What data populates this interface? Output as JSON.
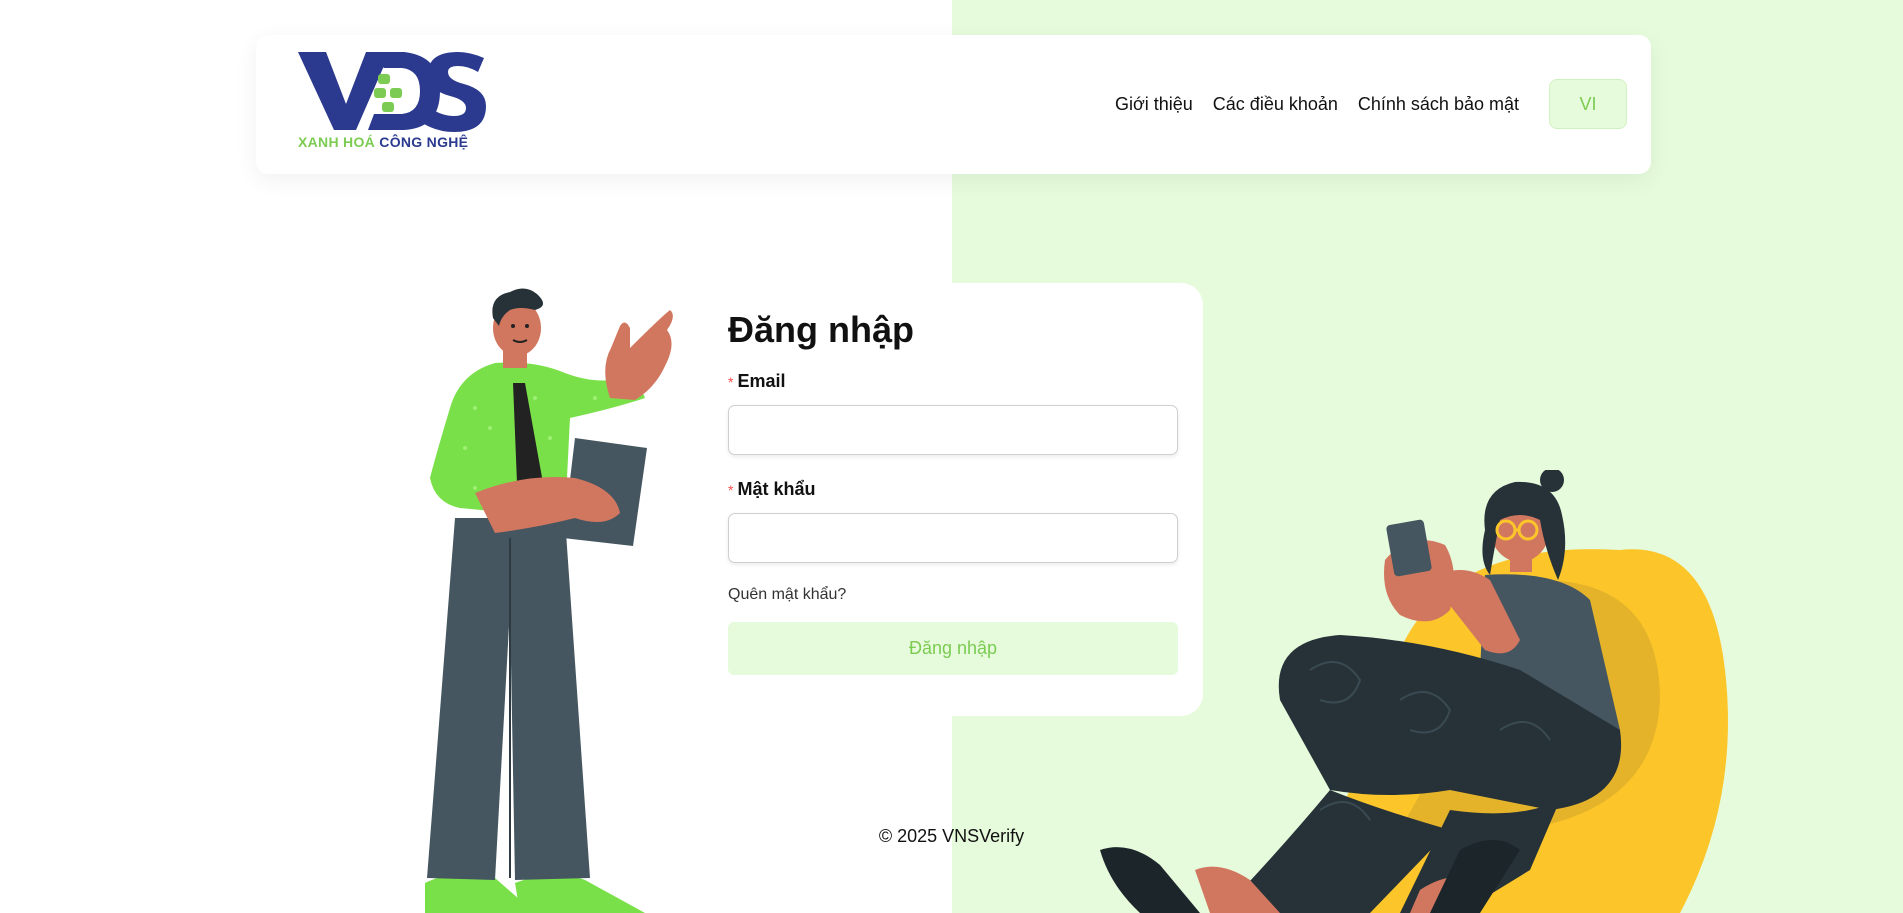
{
  "header": {
    "logo": {
      "mark": "VDS",
      "tagline_green": "XANH HOÁ",
      "tagline_blue": "CÔNG NGHỆ"
    },
    "nav": [
      {
        "label": "Giới thiệu"
      },
      {
        "label": "Các điều khoản"
      },
      {
        "label": "Chính sách bảo mật"
      }
    ],
    "language_button": "VI"
  },
  "login": {
    "title": "Đăng nhập",
    "required_mark": "*",
    "email_label": "Email",
    "email_value": "",
    "password_label": "Mật khẩu",
    "password_value": "",
    "forgot_password": "Quên mật khẩu?",
    "submit_label": "Đăng nhập"
  },
  "footer": {
    "copyright": "© 2025 VNSVerify"
  },
  "colors": {
    "accent_green": "#7ccb52",
    "light_green_bg": "#e6fbdc",
    "brand_blue": "#2b3a8f",
    "required_red": "#ff4d4f",
    "chair_yellow": "#fcc62b"
  },
  "illustrations": {
    "left": "man-pointing-illustration",
    "right": "woman-with-phone-illustration"
  }
}
